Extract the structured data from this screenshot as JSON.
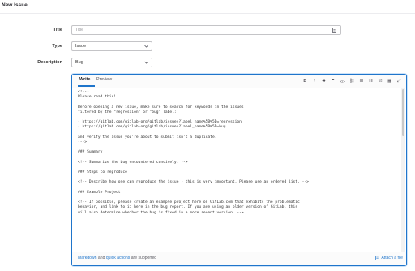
{
  "page": {
    "title": "New Issue"
  },
  "form": {
    "title_label": "Title",
    "title_placeholder": "Title",
    "type_label": "Type",
    "type_value": "Issue",
    "description_label": "Description",
    "template_value": "Bug"
  },
  "editor": {
    "tabs": [
      "Write",
      "Preview"
    ],
    "toolbar": [
      {
        "name": "bold",
        "glyph": "B",
        "icon": "bold-icon"
      },
      {
        "name": "italic",
        "glyph": "I",
        "icon": "italic-icon"
      },
      {
        "name": "strikethrough",
        "glyph": "S",
        "icon": "strikethrough-icon"
      },
      {
        "name": "quote",
        "glyph": "❞",
        "icon": "quote-icon"
      },
      {
        "name": "code",
        "glyph": "</>",
        "icon": "code-icon"
      },
      {
        "name": "link",
        "glyph": "⛓",
        "icon": "link-icon"
      },
      {
        "name": "bulleted-list",
        "glyph": "☰",
        "icon": "bulleted-list-icon"
      },
      {
        "name": "numbered-list",
        "glyph": "☷",
        "icon": "numbered-list-icon"
      },
      {
        "name": "task-list",
        "glyph": "☑",
        "icon": "task-list-icon"
      },
      {
        "name": "table",
        "glyph": "▦",
        "icon": "table-icon"
      },
      {
        "name": "fullscreen",
        "glyph": "⤢",
        "icon": "fullscreen-icon"
      }
    ],
    "lines": [
      "<!---",
      "Please read this!",
      "",
      "Before opening a new issue, make sure to search for keywords in the issues",
      "filtered by the \"regression\" or \"bug\" label:",
      "",
      "- https://gitlab.com/gitlab-org/gitlab/issues?label_name%5B%5D=regression",
      "- https://gitlab.com/gitlab-org/gitlab/issues?label_name%5B%5D=bug",
      "",
      "and verify the issue you're about to submit isn't a duplicate.",
      "--->",
      "",
      "### Summary",
      "",
      "<!-- Summarize the bug encountered concisely. -->",
      "",
      "### Steps to reproduce",
      "",
      "<!-- Describe how one can reproduce the issue - this is very important. Please use an ordered list. -->",
      "",
      "### Example Project",
      "",
      "<!-- If possible, please create an example project here on GitLab.com that exhibits the problematic",
      "behavior, and link to it here in the bug report. If you are using an older version of GitLab, this",
      "will also determine whether the bug is fixed in a more recent version. -->",
      ""
    ],
    "footer": {
      "markdown_link": "Markdown",
      "and": " and ",
      "quick_actions_link": "quick actions",
      "supported": " are supported",
      "attach": "Attach a file"
    }
  },
  "colors": {
    "accent": "#1f75cb",
    "border": "#c4c4c7",
    "spellcheck": "#dd2b0e"
  }
}
